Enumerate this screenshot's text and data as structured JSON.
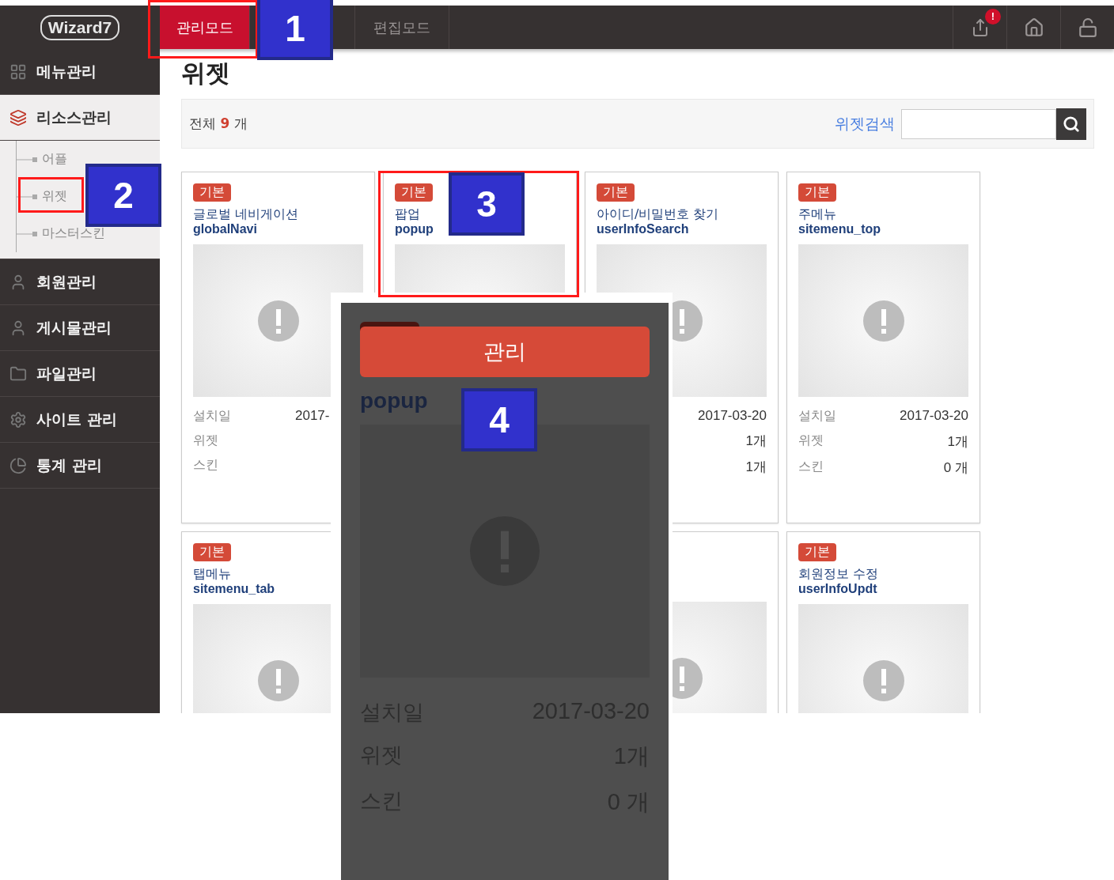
{
  "logo": "Wizard7",
  "top_tabs": [
    {
      "label": "관리모드",
      "selected": true
    },
    {
      "label": "편집모드",
      "selected": false
    }
  ],
  "notification_badge": "!",
  "sidebar": [
    {
      "label": "메뉴관리",
      "expanded": false
    },
    {
      "label": "리소스관리",
      "expanded": true,
      "children": [
        {
          "label": "어플"
        },
        {
          "label": "위젯"
        },
        {
          "label": "마스터스킨"
        }
      ]
    },
    {
      "label": "회원관리",
      "expanded": false
    },
    {
      "label": "게시물관리",
      "expanded": false
    },
    {
      "label": "파일관리",
      "expanded": false
    },
    {
      "label": "사이트 관리",
      "expanded": false
    },
    {
      "label": "통계 관리",
      "expanded": false
    }
  ],
  "page_title": "위젯",
  "total": {
    "prefix": "전체",
    "count": "9",
    "suffix": "개"
  },
  "search": {
    "label": "위젯검색"
  },
  "card_rows": [
    [
      {
        "kind": "cut",
        "badge": "기본",
        "title": "글로벌 네비게이션",
        "name": "globalNavi",
        "stats": [
          {
            "label": "설치일",
            "value": "2017-"
          },
          {
            "label": "위젯"
          },
          {
            "label": "스킨"
          }
        ]
      },
      {
        "kind": "covered",
        "badge": "기본",
        "title": "팝업",
        "name": "popup"
      },
      {
        "kind": "plain",
        "badge": "기본",
        "title": "아이디/비밀번호 찾기",
        "name": "userInfoSearch",
        "stats": [
          {
            "value": "2017-03-20"
          },
          {
            "value": "1개"
          },
          {
            "value": "1개"
          }
        ]
      },
      {
        "kind": "plain",
        "badge": "기본",
        "title": "주메뉴",
        "name": "sitemenu_top",
        "stats": [
          {
            "label": "설치일",
            "value": "2017-03-20"
          },
          {
            "label": "위젯",
            "value": "1개"
          },
          {
            "label": "스킨",
            "value": "0 개"
          }
        ]
      }
    ],
    [
      {
        "kind": "plain",
        "badge": "기본",
        "title": "탭메뉴",
        "name": "sitemenu_tab"
      },
      null,
      {
        "kind": "plain"
      },
      {
        "kind": "plain",
        "badge": "기본",
        "title": "회원정보 수정",
        "name": "userInfoUpdt"
      }
    ]
  ],
  "zoom_inset": {
    "button": "관리",
    "name": "popup",
    "stats": [
      {
        "label": "설치일",
        "value": "2017-03-20"
      },
      {
        "label": "위젯",
        "value": "1개"
      },
      {
        "label": "스킨",
        "value": "0 개"
      }
    ]
  },
  "step_labels": [
    "1",
    "2",
    "3",
    "4"
  ]
}
